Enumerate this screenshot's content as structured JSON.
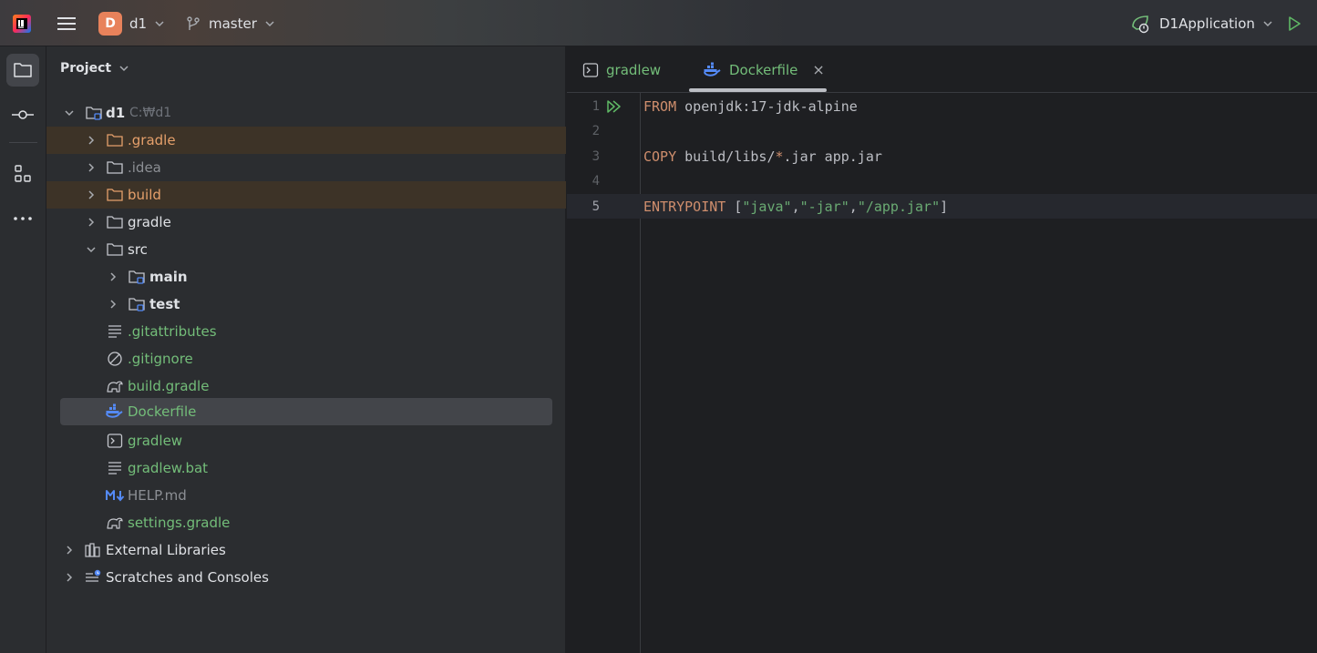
{
  "topbar": {
    "project_initial": "D",
    "project_name": "d1",
    "branch_name": "master",
    "run_config": "D1Application"
  },
  "project_panel": {
    "title": "Project",
    "root": {
      "label": "d1",
      "path": "C:₩d1"
    },
    "items": [
      {
        "label": ".gradle"
      },
      {
        "label": ".idea"
      },
      {
        "label": "build"
      },
      {
        "label": "gradle"
      },
      {
        "label": "src"
      },
      {
        "label": "main"
      },
      {
        "label": "test"
      },
      {
        "label": ".gitattributes"
      },
      {
        "label": ".gitignore"
      },
      {
        "label": "build.gradle"
      },
      {
        "label": "Dockerfile"
      },
      {
        "label": "gradlew"
      },
      {
        "label": "gradlew.bat"
      },
      {
        "label": "HELP.md"
      },
      {
        "label": "settings.gradle"
      },
      {
        "label": "External Libraries"
      },
      {
        "label": "Scratches and Consoles"
      }
    ]
  },
  "editor": {
    "tabs": [
      {
        "label": "gradlew"
      },
      {
        "label": "Dockerfile",
        "close": "×"
      }
    ],
    "lines": [
      {
        "num": "1",
        "kw": "FROM",
        "rest": " openjdk:17-jdk-alpine"
      },
      {
        "num": "2"
      },
      {
        "num": "3",
        "kw": "COPY",
        "rest": " build/libs/",
        "op": "*",
        "rest2": ".jar app.jar"
      },
      {
        "num": "4"
      },
      {
        "num": "5",
        "kw": "ENTRYPOINT",
        "p1": " [",
        "s1": "\"java\"",
        "c1": ",",
        "s2": "\"-jar\"",
        "c2": ",",
        "s3": "\"/app.jar\"",
        "p2": "]"
      }
    ]
  },
  "colors": {
    "accent_green": "#73bd79",
    "modified_orange": "#e5a06b",
    "keyword": "#cf8e6d",
    "string": "#6aab73",
    "project_badge": "#e8825b"
  }
}
